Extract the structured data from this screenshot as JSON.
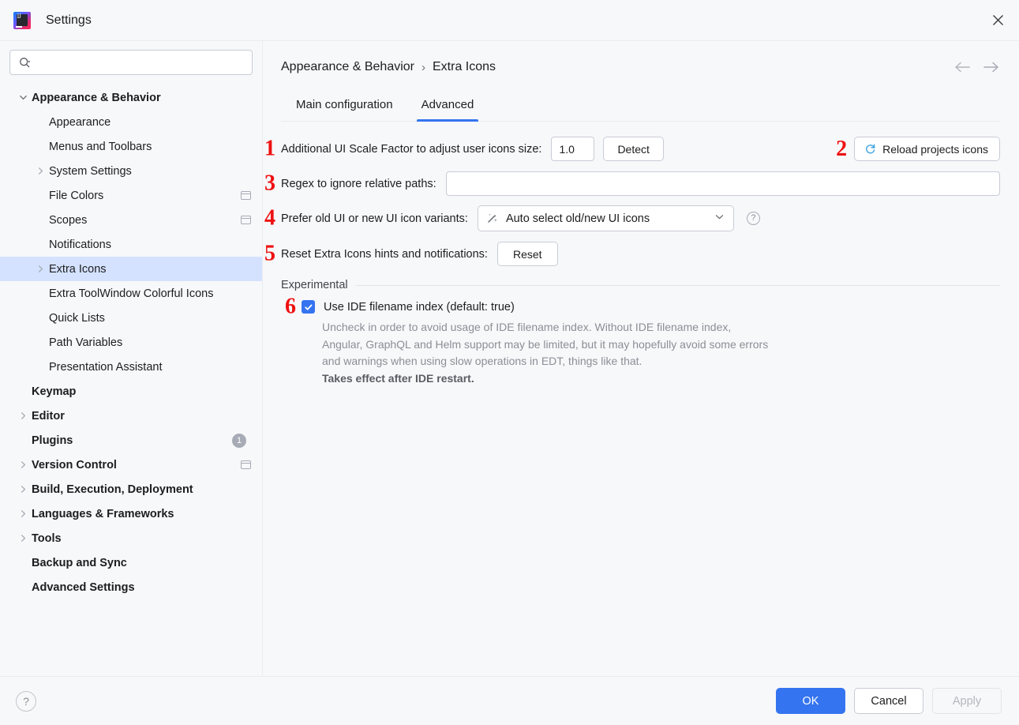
{
  "window": {
    "title": "Settings",
    "logo_text": "IJ",
    "close_icon": "close-icon"
  },
  "search": {
    "value": "",
    "placeholder": ""
  },
  "sidebar": {
    "items": [
      {
        "label": "Appearance & Behavior",
        "level": 0,
        "expander": "down",
        "selected": false,
        "project_icon": false,
        "badge": ""
      },
      {
        "label": "Appearance",
        "level": 1,
        "expander": "none",
        "selected": false,
        "project_icon": false,
        "badge": ""
      },
      {
        "label": "Menus and Toolbars",
        "level": 1,
        "expander": "none",
        "selected": false,
        "project_icon": false,
        "badge": ""
      },
      {
        "label": "System Settings",
        "level": 1,
        "expander": "right",
        "selected": false,
        "project_icon": false,
        "badge": ""
      },
      {
        "label": "File Colors",
        "level": 1,
        "expander": "none",
        "selected": false,
        "project_icon": true,
        "badge": ""
      },
      {
        "label": "Scopes",
        "level": 1,
        "expander": "none",
        "selected": false,
        "project_icon": true,
        "badge": ""
      },
      {
        "label": "Notifications",
        "level": 1,
        "expander": "none",
        "selected": false,
        "project_icon": false,
        "badge": ""
      },
      {
        "label": "Extra Icons",
        "level": 1,
        "expander": "right",
        "selected": true,
        "project_icon": false,
        "badge": ""
      },
      {
        "label": "Extra ToolWindow Colorful Icons",
        "level": 1,
        "expander": "none",
        "selected": false,
        "project_icon": false,
        "badge": ""
      },
      {
        "label": "Quick Lists",
        "level": 1,
        "expander": "none",
        "selected": false,
        "project_icon": false,
        "badge": ""
      },
      {
        "label": "Path Variables",
        "level": 1,
        "expander": "none",
        "selected": false,
        "project_icon": false,
        "badge": ""
      },
      {
        "label": "Presentation Assistant",
        "level": 1,
        "expander": "none",
        "selected": false,
        "project_icon": false,
        "badge": ""
      },
      {
        "label": "Keymap",
        "level": 0,
        "expander": "none",
        "selected": false,
        "project_icon": false,
        "badge": ""
      },
      {
        "label": "Editor",
        "level": 0,
        "expander": "right",
        "selected": false,
        "project_icon": false,
        "badge": ""
      },
      {
        "label": "Plugins",
        "level": 0,
        "expander": "none",
        "selected": false,
        "project_icon": false,
        "badge": "1"
      },
      {
        "label": "Version Control",
        "level": 0,
        "expander": "right",
        "selected": false,
        "project_icon": true,
        "badge": ""
      },
      {
        "label": "Build, Execution, Deployment",
        "level": 0,
        "expander": "right",
        "selected": false,
        "project_icon": false,
        "badge": ""
      },
      {
        "label": "Languages & Frameworks",
        "level": 0,
        "expander": "right",
        "selected": false,
        "project_icon": false,
        "badge": ""
      },
      {
        "label": "Tools",
        "level": 0,
        "expander": "right",
        "selected": false,
        "project_icon": false,
        "badge": ""
      },
      {
        "label": "Backup and Sync",
        "level": 0,
        "expander": "none",
        "selected": false,
        "project_icon": false,
        "badge": ""
      },
      {
        "label": "Advanced Settings",
        "level": 0,
        "expander": "none",
        "selected": false,
        "project_icon": false,
        "badge": ""
      }
    ]
  },
  "breadcrumb": {
    "root": "Appearance & Behavior",
    "separator": "›",
    "current": "Extra Icons"
  },
  "nav": {
    "back_icon": "arrow-left-icon",
    "forward_icon": "arrow-right-icon"
  },
  "tabs": [
    {
      "label": "Main configuration",
      "active": false
    },
    {
      "label": "Advanced",
      "active": true
    }
  ],
  "settings": {
    "scale": {
      "marker": "1",
      "label": "Additional UI Scale Factor to adjust user icons size:",
      "value": "1.0",
      "detect_label": "Detect"
    },
    "reload": {
      "marker": "2",
      "label": "Reload projects icons",
      "icon": "refresh-icon"
    },
    "regex": {
      "marker": "3",
      "label": "Regex to ignore relative paths:",
      "value": "",
      "placeholder": ""
    },
    "variants": {
      "marker": "4",
      "label": "Prefer old UI or new UI icon variants:",
      "selected": "Auto select old/new UI icons",
      "icon": "magic-wand-icon",
      "help_icon": "question-circle-icon"
    },
    "reset": {
      "marker": "5",
      "label": "Reset Extra Icons hints and notifications:",
      "button_label": "Reset"
    }
  },
  "experimental": {
    "title": "Experimental",
    "checkbox": {
      "marker": "6",
      "label": "Use IDE filename index (default: true)",
      "checked": true
    },
    "description_line1": "Uncheck in order to avoid usage of IDE filename index. Without IDE filename index,",
    "description_line2": "Angular, GraphQL and Helm support may be limited, but it may hopefully avoid some errors",
    "description_line3": "and warnings when using slow operations in EDT, things like that.",
    "description_strong": "Takes effect after IDE restart."
  },
  "footer": {
    "help_label": "?",
    "ok_label": "OK",
    "cancel_label": "Cancel",
    "apply_label": "Apply"
  },
  "colors": {
    "accent": "#3574f0",
    "selection": "#d4e2ff",
    "marker_red": "#ee1111",
    "panel_bg": "#f7f8fa",
    "muted_text": "#8b8e95"
  }
}
